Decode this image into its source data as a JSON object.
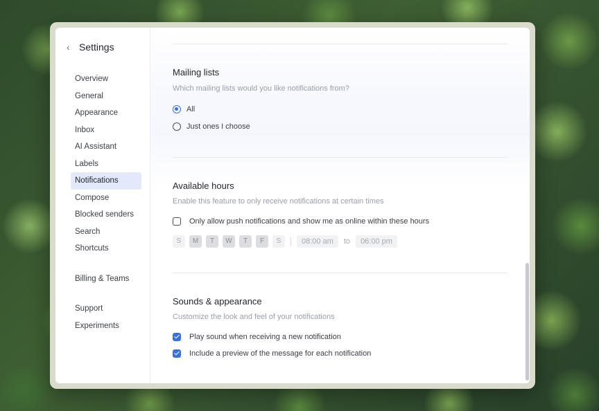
{
  "sidebar": {
    "back_label": "‹",
    "title": "Settings",
    "items": [
      {
        "label": "Overview"
      },
      {
        "label": "General"
      },
      {
        "label": "Appearance"
      },
      {
        "label": "Inbox"
      },
      {
        "label": "AI Assistant"
      },
      {
        "label": "Labels"
      },
      {
        "label": "Notifications",
        "active": true
      },
      {
        "label": "Compose"
      },
      {
        "label": "Blocked senders"
      },
      {
        "label": "Search"
      },
      {
        "label": "Shortcuts"
      }
    ],
    "billing": "Billing & Teams",
    "support": "Support",
    "experiments": "Experiments"
  },
  "mailing": {
    "title": "Mailing lists",
    "description": "Which mailing lists would you like notifications from?",
    "options": [
      {
        "label": "All",
        "checked": true
      },
      {
        "label": "Just ones I choose",
        "checked": false
      }
    ]
  },
  "hours": {
    "title": "Available hours",
    "description": "Enable this feature to only receive notifications at certain times",
    "toggle_label": "Only allow push notifications and show me as online within these hours",
    "toggle_checked": false,
    "days": [
      {
        "label": "S",
        "on": false
      },
      {
        "label": "M",
        "on": true
      },
      {
        "label": "T",
        "on": true
      },
      {
        "label": "W",
        "on": true
      },
      {
        "label": "T",
        "on": true
      },
      {
        "label": "F",
        "on": true
      },
      {
        "label": "S",
        "on": false
      }
    ],
    "start": "08:00 am",
    "to": "to",
    "end": "06:00 pm"
  },
  "sounds": {
    "title": "Sounds & appearance",
    "description": "Customize the look and feel of your notifications",
    "options": [
      {
        "label": "Play sound when receiving a new notification",
        "checked": true
      },
      {
        "label": "Include a preview of the message for each notification",
        "checked": true
      }
    ]
  },
  "colors": {
    "accent": "#3b6fe0",
    "active_nav": "#e3e8fb"
  }
}
